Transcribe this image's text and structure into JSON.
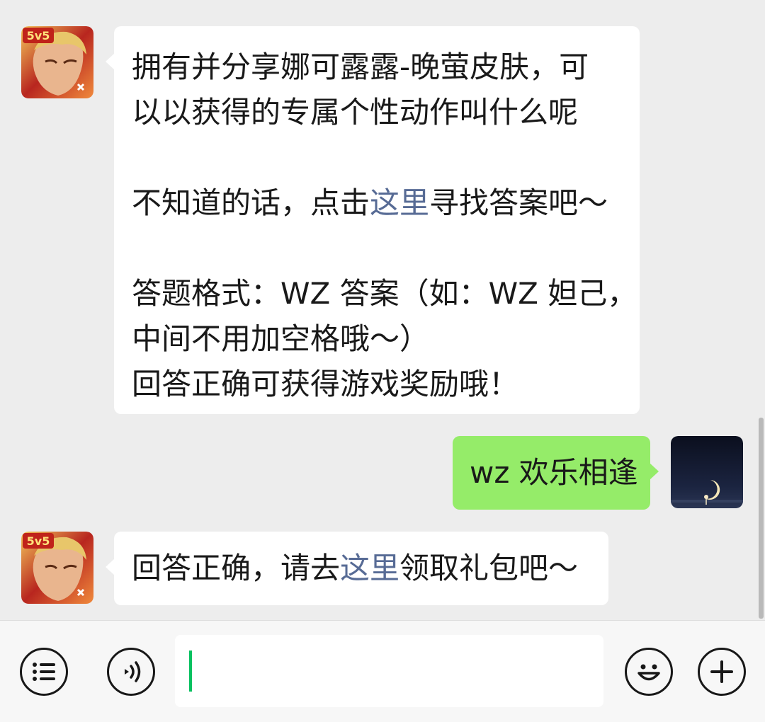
{
  "messages": [
    {
      "sender": "game-bot",
      "lines": [
        "拥有并分享娜可露露-晚萤皮肤，可",
        "以以获得的专属个性动作叫什么呢"
      ],
      "hint": {
        "before": "不知道的话，点击",
        "link": "这里",
        "after": "寻找答案吧～"
      },
      "format_lines": [
        "答题格式：WZ 答案（如：WZ 妲己，",
        "中间不用加空格哦～）",
        "回答正确可获得游戏奖励哦！"
      ]
    },
    {
      "sender": "user",
      "text": "wz 欢乐相逢"
    },
    {
      "sender": "game-bot",
      "before": "回答正确，请去",
      "link": "这里",
      "after": "领取礼包吧～"
    }
  ],
  "bot_avatar": {
    "badge": "5v5"
  },
  "colors": {
    "background": "#ededed",
    "incoming_bubble": "#ffffff",
    "outgoing_bubble": "#95ec69",
    "link": "#576b95",
    "caret": "#07c160"
  },
  "toolbar": {
    "left_icons": [
      "menu-icon",
      "voice-icon"
    ],
    "right_icons": [
      "emoji-icon",
      "plus-icon"
    ],
    "input_value": ""
  }
}
